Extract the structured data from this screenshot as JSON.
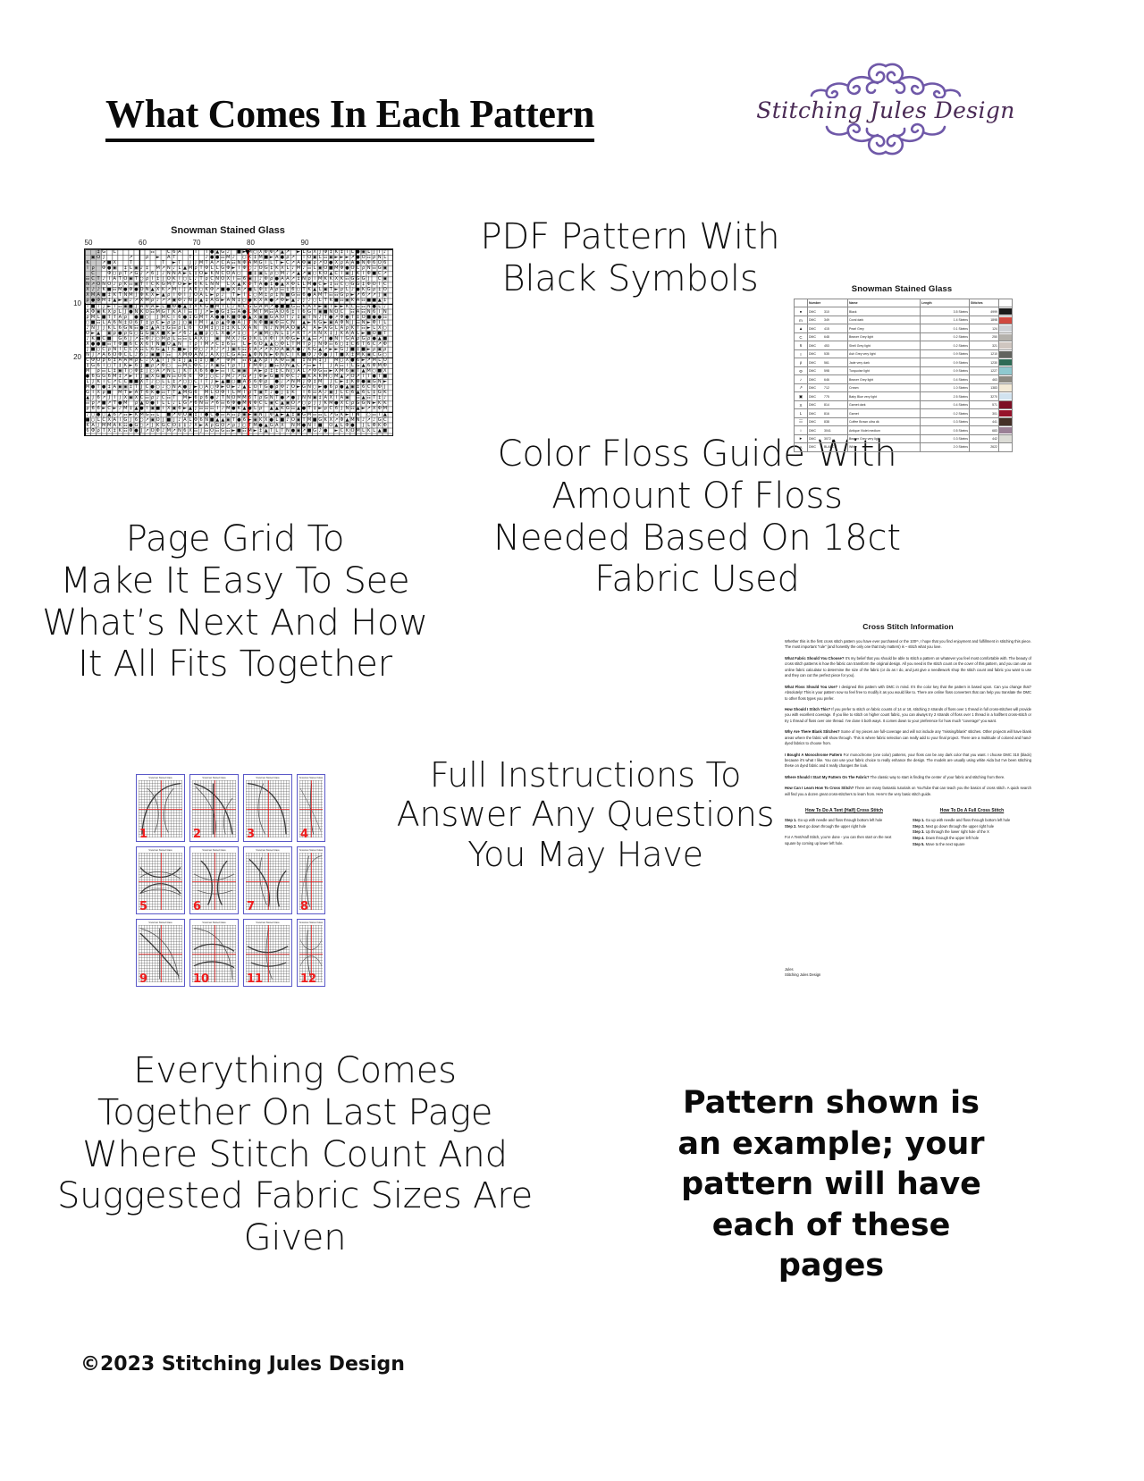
{
  "header": {
    "title": "What Comes In Each Pattern",
    "logo": {
      "brand": "Stitching Jules Design",
      "flourish_color": "#6f58a8",
      "text_color": "#4a2a55"
    }
  },
  "captions": {
    "pdf_pattern": "PDF Pattern With\nBlack Symbols",
    "page_grid": "Page Grid To\nMake It Easy To See\nWhat’s Next And How\nIt All Fits Together",
    "floss_guide": "Color Floss Guide With\nAmount Of Floss\nNeeded Based On 18ct\nFabric Used",
    "instructions": "Full Instructions To\nAnswer Any Questions\nYou May Have",
    "last_page": "Everything Comes\nTogether On Last Page\nWhere Stitch Count And\nSuggested Fabric Sizes Are\nGiven",
    "disclaimer": "Pattern shown is an example; your pattern will have each of these pages"
  },
  "footer": {
    "copyright": "©2023 Stitching Jules Design"
  },
  "chart_data": {
    "type": "heatmap",
    "title": "Snowman Stained Glass",
    "xlabel": "",
    "ylabel": "",
    "x_ticks": [
      50,
      60,
      70,
      80,
      90
    ],
    "y_ticks": [
      10,
      20
    ],
    "grid": true,
    "center_marker": "red vertical center line at column 80",
    "symbols": [
      "●",
      "■",
      "▲",
      "C",
      "6",
      "I",
      "ρ",
      "Φ",
      "♪",
      "↗",
      "▣",
      "X",
      "L",
      "☷",
      "○",
      "►",
      "A",
      "J",
      "K",
      "O",
      "M",
      "N",
      "T",
      "G",
      "‡"
    ],
    "note": "Black-symbol cross stitch chart with 10-square major gridlines"
  },
  "floss_guide": {
    "title": "Snowman Stained Glass",
    "columns": [
      "",
      "Number",
      "Name",
      "Length",
      "Stitches",
      ""
    ],
    "rows": [
      {
        "symbol": "●",
        "brand": "DMC",
        "number": "310",
        "name": "Black",
        "length": "3.5 Skeins",
        "stitches": "4999",
        "color": "#1a1a1a"
      },
      {
        "symbol": "m",
        "brand": "DMC",
        "number": "349",
        "name": "Coral dark",
        "length": "1.4 Skeins",
        "stitches": "1898",
        "color": "#d0483f"
      },
      {
        "symbol": "▲",
        "brand": "DMC",
        "number": "415",
        "name": "Pearl Grey",
        "length": "0.1 Skeins",
        "stitches": "124",
        "color": "#cfd2d6"
      },
      {
        "symbol": "C",
        "brand": "DMC",
        "number": "648",
        "name": "Beaver Grey light",
        "length": "0.2 Skeins",
        "stitches": "250",
        "color": "#b4b1ab"
      },
      {
        "symbol": "6",
        "brand": "DMC",
        "number": "453",
        "name": "Shell Grey light",
        "length": "0.2 Skeins",
        "stitches": "321",
        "color": "#cfc6c0"
      },
      {
        "symbol": "I",
        "brand": "DMC",
        "number": "535",
        "name": "Ash Grey very light",
        "length": "0.9 Skeins",
        "stitches": "1210",
        "color": "#62635e"
      },
      {
        "symbol": "ρ",
        "brand": "DMC",
        "number": "561",
        "name": "Jade very dark",
        "length": "0.9 Skeins",
        "stitches": "1230",
        "color": "#2e6b55"
      },
      {
        "symbol": "Φ",
        "brand": "DMC",
        "number": "598",
        "name": "Turquoise light",
        "length": "0.9 Skeins",
        "stitches": "1227",
        "color": "#8fc9cf"
      },
      {
        "symbol": "♪",
        "brand": "DMC",
        "number": "646",
        "name": "Beaver Grey light",
        "length": "0.4 Skeins",
        "stitches": "463",
        "color": "#8d8a82"
      },
      {
        "symbol": "↗",
        "brand": "DMC",
        "number": "712",
        "name": "Cream",
        "length": "1.0 Skeins",
        "stitches": "1383",
        "color": "#f3ead6"
      },
      {
        "symbol": "▣",
        "brand": "DMC",
        "number": "775",
        "name": "Baby Blue very light",
        "length": "2.5 Skeins",
        "stitches": "3270",
        "color": "#d2e3ef"
      },
      {
        "symbol": "X",
        "brand": "DMC",
        "number": "814",
        "name": "Garnet dark",
        "length": "0.4 Skeins",
        "stitches": "571",
        "color": "#7d1025"
      },
      {
        "symbol": "L",
        "brand": "DMC",
        "number": "816",
        "name": "Garnet",
        "length": "0.2 Skeins",
        "stitches": "301",
        "color": "#97122b"
      },
      {
        "symbol": "☷",
        "brand": "DMC",
        "number": "838",
        "name": "Coffee Brown ultra dk",
        "length": "0.3 Skeins",
        "stitches": "441",
        "color": "#453027"
      },
      {
        "symbol": "○",
        "brand": "DMC",
        "number": "3041",
        "name": "Antique Violet medium",
        "length": "0.5 Skeins",
        "stitches": "683",
        "color": "#9b8096"
      },
      {
        "symbol": "►",
        "brand": "DMC",
        "number": "3072",
        "name": "Beaver Grey very light",
        "length": "0.3 Skeins",
        "stitches": "442",
        "color": "#dcdcd6"
      },
      {
        "symbol": "A",
        "brand": "DMC",
        "number": "BLANC",
        "name": "White",
        "length": "2.0 Skeins",
        "stitches": "2622",
        "color": "#ffffff"
      }
    ]
  },
  "page_grid": {
    "thumbnail_title": "Snowman Stained Glass",
    "pages": [
      {
        "number": "1"
      },
      {
        "number": "2"
      },
      {
        "number": "3"
      },
      {
        "number": "4"
      },
      {
        "number": "5"
      },
      {
        "number": "6"
      },
      {
        "number": "7"
      },
      {
        "number": "8"
      },
      {
        "number": "9"
      },
      {
        "number": "10"
      },
      {
        "number": "11"
      },
      {
        "number": "12"
      }
    ],
    "border_color": "#5a58c8",
    "number_color": "#ef1d1d"
  },
  "instructions_sheet": {
    "title": "Cross Stitch Information",
    "intro": "Whether this is the first cross stitch pattern you have ever purchased or the 100ᵗʰ, I hope that you find enjoyment and fulfillment in stitching this piece. The most important “rule” (and honestly the only one that truly matters) is – stitch what you love.",
    "intro_emphasis": "stitch what you love",
    "sections": [
      {
        "heading": "What Fabric Should You Choose?",
        "body": " It’s my belief that you should be able to stitch a pattern on whatever you feel most comfortable with. The beauty of cross stitch patterns is how the fabric can transform the original design. All you need is the stitch count on the cover of this pattern, and you can use an online fabric calculator to determine the size of the fabric (or do as I do, and just give a needlework shop the stitch count and fabric you want to use and they can cut the perfect piece for you)."
      },
      {
        "heading": "What Floss Should You Use?",
        "body": " I designed this pattern with DMC in mind. It’s the color key that the pattern is based upon. Can you change that? Absolutely! This is your pattern now so feel free to modify it as you would like to. There are online floss converters that can help you translate the DMC to other floss types you prefer."
      },
      {
        "heading": "How Should I Stitch This?",
        "body": " If you prefer to stitch on fabric counts of 14 or 18, stitching 2 strands of floss over 1 thread in full cross-stitches will provide you with excellent coverage. If you like to stitch on higher count fabric, you can always try 2 strands of floss over 1 thread in a half/tent cross-stitch or try 1 thread of floss over one thread. I’ve done it both ways. It comes down to your preference for how much “coverage” you want."
      },
      {
        "heading": "Why Are There Blank Stitches?",
        "body": " Some of my pieces are full-coverage and will not include any “missing/blank” stitches. Other projects will have blank areas where the fabric will show through. This is where fabric selection can really add to your final project. There are a multitude of colored and hand-dyed fabrics to choose from."
      },
      {
        "heading": "I Bought A Monochrome Pattern",
        "body": " For monochrome (one color) patterns, your floss can be any dark color that you want. I choose DMC 310 (black) because it’s what I like. You can use your fabric choice to really enhance the design. The models are usually using white Aida but I’ve been stitching these on dyed fabric and it really changes the look."
      },
      {
        "heading": "Where Should I Start My Pattern On The Fabric?",
        "body": " The classic way to start is finding the center of your fabric and stitching from there."
      },
      {
        "heading": "How Can I Learn How To Cross Stitch?",
        "body": " There are many fantastic tutorials on YouTube that can teach you the basics of cross stitch. A quick search will find you a dozen great cross-stitchers to learn from. Here’s the very basic stitch guide."
      }
    ],
    "guides": [
      {
        "heading": "How To Do A Tent (Half) Cross Stitch",
        "steps": [
          "Step 1. Go up with needle and floss through bottom left hole",
          "Step 2. Next go down through the upper right hole"
        ],
        "note": "For A Tent/Half Stitch, you’re done - you can then start on the next square by coming up lower left hole."
      },
      {
        "heading": "How To Do A Full Cross Stitch",
        "steps": [
          "Step 1. Go up with needle and floss through bottom left hole",
          "Step 2. Next go down through the upper right hole",
          "Step 3. Up through the lower right hole of the X",
          "Step 4. Down through the upper left hole",
          "Step 5. Move to the next square"
        ],
        "note": ""
      }
    ],
    "signature": "Jules\nStitching Jules Design"
  }
}
